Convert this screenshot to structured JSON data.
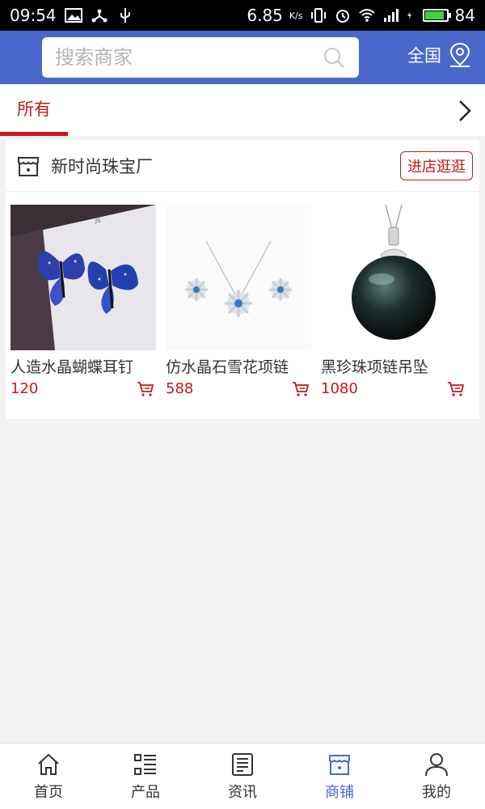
{
  "status_bar": {
    "time": "09:54",
    "net_speed": "6.85",
    "net_unit": "K/s",
    "battery": "84",
    "battery_level": 0.84
  },
  "header": {
    "search_placeholder": "搜索商家",
    "location_label": "全国"
  },
  "tabs": {
    "active": "所有"
  },
  "store": {
    "name": "新时尚珠宝厂",
    "visit_label": "进店逛逛"
  },
  "products": [
    {
      "name": "人造水晶蝴蝶耳钉",
      "price": "120"
    },
    {
      "name": "仿水晶石雪花项链",
      "price": "588"
    },
    {
      "name": "黑珍珠项链吊坠",
      "price": "1080"
    }
  ],
  "bottom_nav": [
    {
      "label": "首页",
      "icon": "home-icon"
    },
    {
      "label": "产品",
      "icon": "list-icon"
    },
    {
      "label": "资讯",
      "icon": "news-icon"
    },
    {
      "label": "商铺",
      "icon": "store-icon"
    },
    {
      "label": "我的",
      "icon": "user-icon"
    }
  ],
  "colors": {
    "header_blue": "#4a68cc",
    "accent_red": "#c7171b"
  }
}
